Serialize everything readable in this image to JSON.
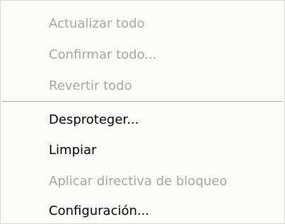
{
  "menu": {
    "items": [
      {
        "label": "Actualizar todo",
        "enabled": false
      },
      {
        "label": "Confirmar todo...",
        "enabled": false
      },
      {
        "label": "Revertir todo",
        "enabled": false
      },
      {
        "label": "Desproteger...",
        "enabled": true
      },
      {
        "label": "Limpiar",
        "enabled": true
      },
      {
        "label": "Aplicar directiva de bloqueo",
        "enabled": false
      },
      {
        "label": "Configuración...",
        "enabled": true
      }
    ]
  }
}
